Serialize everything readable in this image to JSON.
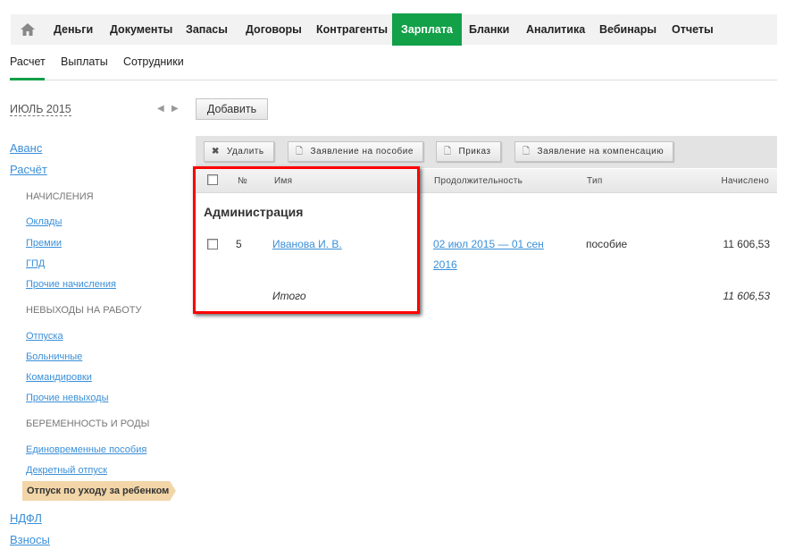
{
  "topnav": {
    "home_icon": "home-icon",
    "items": [
      "Деньги",
      "Документы",
      "Запасы",
      "Договоры",
      "Контрагенты",
      "Зарплата",
      "Бланки",
      "Аналитика",
      "Вебинары",
      "Отчеты"
    ],
    "active": "Зарплата",
    "accent": "#12a049"
  },
  "subtabs": [
    "Расчет",
    "Выплаты",
    "Сотрудники"
  ],
  "period": {
    "label": "ИЮЛЬ 2015",
    "prev": "◀",
    "next": "▶"
  },
  "add_button": "Добавить",
  "sidebar": {
    "top": [
      "Аванс",
      "Расчёт"
    ],
    "cat1": "НАЧИСЛЕНИЯ",
    "cat1_items": [
      "Оклады",
      "Премии",
      "ГПД",
      "Прочие начисления"
    ],
    "cat2": "НЕВЫХОДЫ НА РАБОТУ",
    "cat2_items": [
      "Отпуска",
      "Больничные",
      "Командировки",
      "Прочие невыходы"
    ],
    "cat3": "БЕРЕМЕННОСТЬ И РОДЫ",
    "cat3_items": [
      "Единовременные пособия",
      "Декретный отпуск"
    ],
    "active": "Отпуск по уходу за ребенком",
    "bottom": [
      "НДФЛ",
      "Взносы"
    ]
  },
  "toolbar": {
    "delete": "Удалить",
    "benefit": "Заявление на пособие",
    "order": "Приказ",
    "compensation": "Заявление на компенсацию"
  },
  "table": {
    "headers": {
      "num": "№",
      "name": "Имя",
      "duration": "Продолжительность",
      "type": "Тип",
      "accrued": "Начислено"
    },
    "group": "Администрация",
    "rows": [
      {
        "num": "5",
        "name": "Иванова И. В.",
        "duration_1": "02 июл 2015 — 01 сен",
        "duration_2": "2016",
        "type": "пособие",
        "accrued": "11 606,53"
      }
    ],
    "total_label": "Итого",
    "total": "11 606,53"
  }
}
